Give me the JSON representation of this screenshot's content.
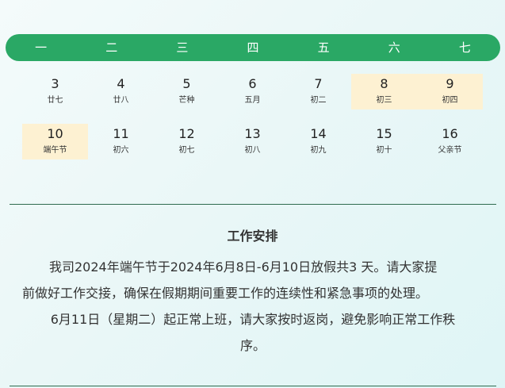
{
  "calendar": {
    "weekdays": [
      "一",
      "二",
      "三",
      "四",
      "五",
      "六",
      "七"
    ],
    "weeks": [
      [
        {
          "day": "3",
          "lunar": "廿七",
          "holiday": false
        },
        {
          "day": "4",
          "lunar": "廿八",
          "holiday": false
        },
        {
          "day": "5",
          "lunar": "芒种",
          "holiday": false
        },
        {
          "day": "6",
          "lunar": "五月",
          "holiday": false
        },
        {
          "day": "7",
          "lunar": "初二",
          "holiday": false
        },
        {
          "day": "8",
          "lunar": "初三",
          "holiday": true
        },
        {
          "day": "9",
          "lunar": "初四",
          "holiday": true
        }
      ],
      [
        {
          "day": "10",
          "lunar": "端午节",
          "holiday": true
        },
        {
          "day": "11",
          "lunar": "初六",
          "holiday": false
        },
        {
          "day": "12",
          "lunar": "初七",
          "holiday": false
        },
        {
          "day": "13",
          "lunar": "初八",
          "holiday": false
        },
        {
          "day": "14",
          "lunar": "初九",
          "holiday": false
        },
        {
          "day": "15",
          "lunar": "初十",
          "holiday": false
        },
        {
          "day": "16",
          "lunar": "父亲节",
          "holiday": false
        }
      ]
    ]
  },
  "notice": {
    "title": "工作安排",
    "line1": "我司2024年端午节于2024年6月8日-6月10日放假共3 天。请大家提",
    "line2": "前做好工作交接，确保在假期期间重要工作的连续性和紧急事项的处理。",
    "line3": "6月11日（星期二）起正常上班，请大家按时返岗，避免影响正常工作秩",
    "line4": "序。"
  },
  "colors": {
    "header_green": "#2aa865",
    "holiday_highlight": "#fdf1d2",
    "divider": "#2f6b4f"
  }
}
